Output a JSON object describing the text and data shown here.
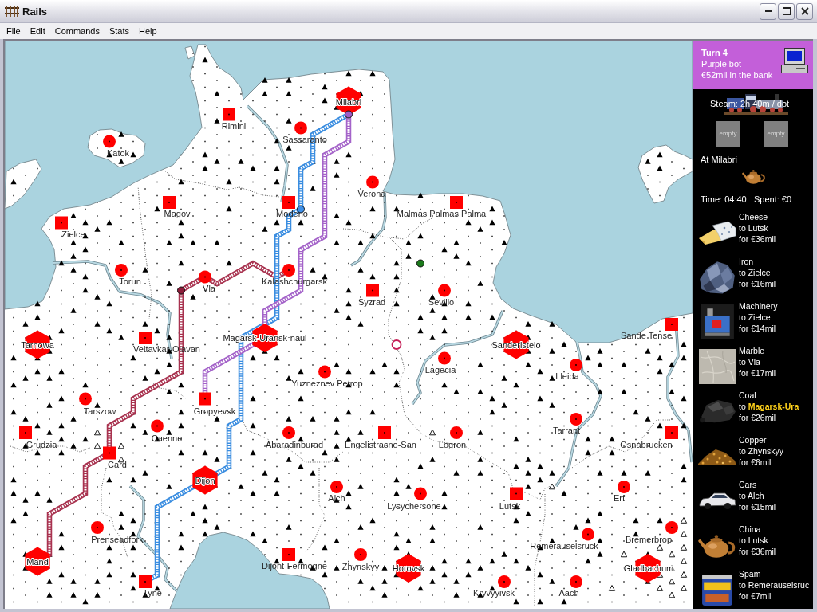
{
  "window": {
    "title": "Rails"
  },
  "menu": [
    "File",
    "Edit",
    "Commands",
    "Stats",
    "Help"
  ],
  "map": {
    "cities": [
      {
        "name": "Milabri",
        "kind": "major"
      },
      {
        "name": "Rimini",
        "kind": "city"
      },
      {
        "name": "Sassaranto",
        "kind": "town"
      },
      {
        "name": "Katok",
        "kind": "town"
      },
      {
        "name": "Verona",
        "kind": "town"
      },
      {
        "name": "Magov",
        "kind": "city"
      },
      {
        "name": "Modeno",
        "kind": "city"
      },
      {
        "name": "Malmas Palmas Palma",
        "kind": "city"
      },
      {
        "name": "Zielce",
        "kind": "city"
      },
      {
        "name": "Torun",
        "kind": "town"
      },
      {
        "name": "Vla",
        "kind": "town"
      },
      {
        "name": "Kalashchurgarsk",
        "kind": "town"
      },
      {
        "name": "Syzrad",
        "kind": "city"
      },
      {
        "name": "Sevillo",
        "kind": "town"
      },
      {
        "name": "Sande Tense",
        "kind": "city"
      },
      {
        "name": "Veltavkar-Olavan",
        "kind": "city"
      },
      {
        "name": "Magarsk-Uransk-naul",
        "kind": "major"
      },
      {
        "name": "Tarnowa",
        "kind": "major"
      },
      {
        "name": "Sanderistelo",
        "kind": "major"
      },
      {
        "name": "Lagecia",
        "kind": "town"
      },
      {
        "name": "Lleida",
        "kind": "town"
      },
      {
        "name": "Yuzneznev Petrop",
        "kind": "town"
      },
      {
        "name": "Tarszow",
        "kind": "town"
      },
      {
        "name": "Gropyevsk",
        "kind": "city"
      },
      {
        "name": "Tarrant",
        "kind": "town"
      },
      {
        "name": "Caenne",
        "kind": "town"
      },
      {
        "name": "Grudzia",
        "kind": "city"
      },
      {
        "name": "Abaradinburad",
        "kind": "town"
      },
      {
        "name": "Engelistrasno-San",
        "kind": "city"
      },
      {
        "name": "Logron",
        "kind": "town"
      },
      {
        "name": "Osnabrucken",
        "kind": "city"
      },
      {
        "name": "Card",
        "kind": "city"
      },
      {
        "name": "Dijon",
        "kind": "major"
      },
      {
        "name": "Alch",
        "kind": "town"
      },
      {
        "name": "Erf",
        "kind": "town"
      },
      {
        "name": "Lysychersone",
        "kind": "town"
      },
      {
        "name": "Lutsk",
        "kind": "city"
      },
      {
        "name": "Prenseadfork",
        "kind": "town"
      },
      {
        "name": "Bremerbrop",
        "kind": "town"
      },
      {
        "name": "Remerauselsruck",
        "kind": "town"
      },
      {
        "name": "Mand",
        "kind": "major"
      },
      {
        "name": "Dijont-Fermogne",
        "kind": "city"
      },
      {
        "name": "Zhynskyy",
        "kind": "town"
      },
      {
        "name": "Horovsk",
        "kind": "major"
      },
      {
        "name": "Gladbachum",
        "kind": "major"
      },
      {
        "name": "Tyne",
        "kind": "city"
      },
      {
        "name": "Kryvyyivsk",
        "kind": "town"
      },
      {
        "name": "Aach",
        "kind": "town"
      }
    ],
    "tracks": [
      {
        "color": "#a8324f"
      },
      {
        "color": "#3a8de0"
      },
      {
        "color": "#a463c9"
      }
    ],
    "trains": [
      {
        "color": "#a05cc8",
        "kind": "filled"
      },
      {
        "color": "#3d8fe8",
        "kind": "filled"
      },
      {
        "color": "#8e1c3a",
        "kind": "filled"
      },
      {
        "color": "#1b7a1b",
        "kind": "filled"
      },
      {
        "color": "#c41d55",
        "kind": "ring"
      }
    ]
  },
  "sidebar": {
    "turn": "Turn 4",
    "player": "Purple bot",
    "bank": "€52mil in the bank",
    "engine": "Steam: 2h 40m / dot",
    "wagons": [
      {
        "label": "empty"
      },
      {
        "label": "empty"
      }
    ],
    "location": "At Milabri",
    "goods_here": [
      {
        "kind": "china"
      }
    ],
    "time": "Time: 04:40",
    "spent": "Spent: €0",
    "demands": [
      {
        "kind": "cheese",
        "cargo": "Cheese",
        "to": "to",
        "destination": "Lutsk",
        "reward": "for €36mil",
        "highlighted": false
      },
      {
        "kind": "iron",
        "cargo": "Iron",
        "to": "to",
        "destination": "Zielce",
        "reward": "for €16mil",
        "highlighted": false
      },
      {
        "kind": "machinery",
        "cargo": "Machinery",
        "to": "to",
        "destination": "Zielce",
        "reward": "for €14mil",
        "highlighted": false
      },
      {
        "kind": "marble",
        "cargo": "Marble",
        "to": "to",
        "destination": "Vla",
        "reward": "for €17mil",
        "highlighted": false
      },
      {
        "kind": "coal",
        "cargo": "Coal",
        "to": "to",
        "destination": "Magarsk-Ura",
        "reward": "for €26mil",
        "highlighted": true
      },
      {
        "kind": "copper",
        "cargo": "Copper",
        "to": "to",
        "destination": "Zhynskyy",
        "reward": "for €6mil",
        "highlighted": false
      },
      {
        "kind": "cars",
        "cargo": "Cars",
        "to": "to",
        "destination": "Alch",
        "reward": "for €15mil",
        "highlighted": false
      },
      {
        "kind": "china",
        "cargo": "China",
        "to": "to",
        "destination": "Lutsk",
        "reward": "for €36mil",
        "highlighted": false
      },
      {
        "kind": "spam",
        "cargo": "Spam",
        "to": "to",
        "destination": "Remerauselsruc",
        "reward": "for €7mil",
        "highlighted": false
      }
    ]
  }
}
